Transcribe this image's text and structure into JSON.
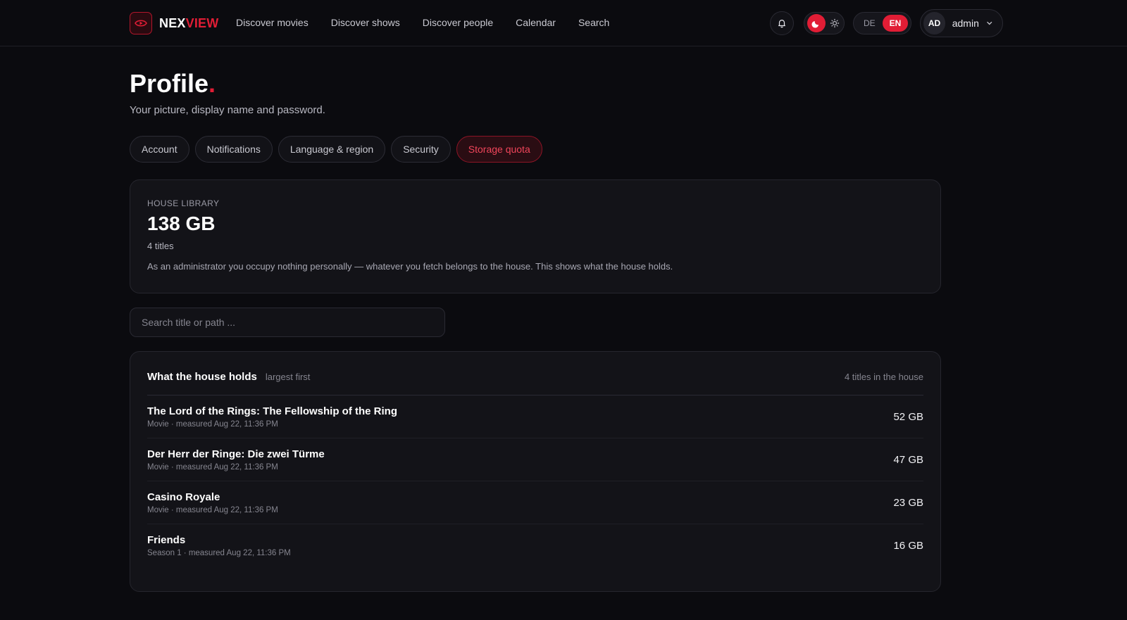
{
  "brand": {
    "part1": "NEX",
    "part2": "VIEW",
    "accent": "#e11d35"
  },
  "nav": [
    {
      "label": "Discover movies"
    },
    {
      "label": "Discover shows"
    },
    {
      "label": "Discover people"
    },
    {
      "label": "Calendar"
    },
    {
      "label": "Search"
    }
  ],
  "topbar": {
    "lang_de": "DE",
    "lang_en": "EN",
    "avatar_initials": "AD",
    "user_name": "admin"
  },
  "page": {
    "title": "Profile",
    "title_dot": ".",
    "subtitle": "Your picture, display name and password."
  },
  "tabs": [
    {
      "label": "Account",
      "active": false
    },
    {
      "label": "Notifications",
      "active": false
    },
    {
      "label": "Language & region",
      "active": false
    },
    {
      "label": "Security",
      "active": false
    },
    {
      "label": "Storage quota",
      "active": true
    }
  ],
  "summary": {
    "eyebrow": "HOUSE LIBRARY",
    "total": "138 GB",
    "count": "4 titles",
    "note": "As an administrator you occupy nothing personally — whatever you fetch belongs to the house. This shows what the house holds."
  },
  "search": {
    "placeholder": "Search title or path ...",
    "value": ""
  },
  "list": {
    "title": "What the house holds",
    "hint": "largest first",
    "count": "4 titles in the house",
    "items": [
      {
        "title": "The Lord of the Rings: The Fellowship of the Ring",
        "meta": "Movie · measured Aug 22, 11:36 PM",
        "size": "52 GB"
      },
      {
        "title": "Der Herr der Ringe: Die zwei Türme",
        "meta": "Movie · measured Aug 22, 11:36 PM",
        "size": "47 GB"
      },
      {
        "title": "Casino Royale",
        "meta": "Movie · measured Aug 22, 11:36 PM",
        "size": "23 GB"
      },
      {
        "title": "Friends",
        "meta": "Season 1  · measured Aug 22, 11:36 PM",
        "size": "16 GB"
      }
    ]
  },
  "icons": {
    "logo": "play-eye-icon",
    "bell": "bell-icon",
    "moon": "moon-icon",
    "sun": "sun-icon",
    "chevron": "chevron-down-icon"
  }
}
